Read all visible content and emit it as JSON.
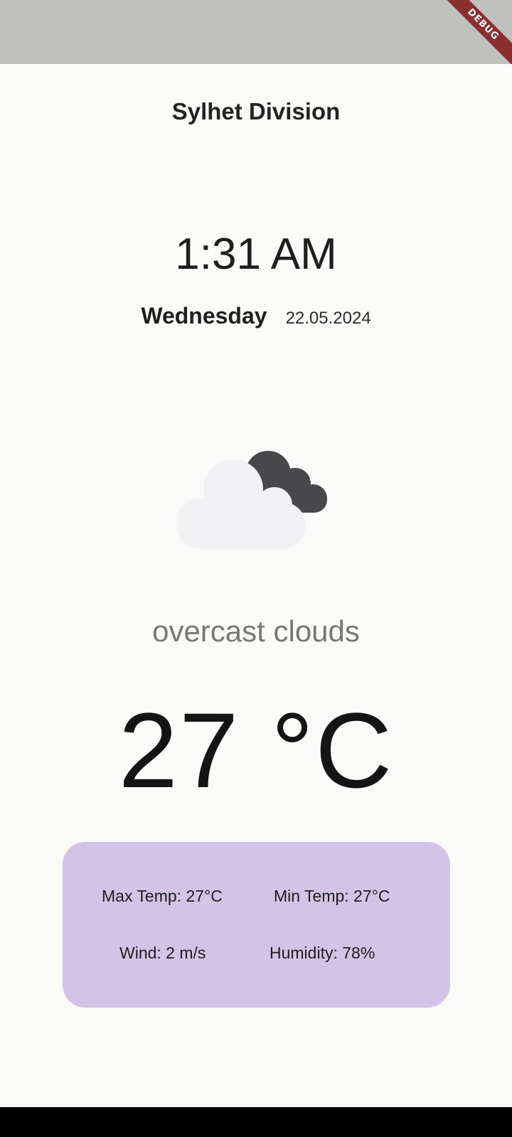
{
  "debug_banner": "DEBUG",
  "location": "Sylhet Division",
  "time": "1:31 AM",
  "day": "Wednesday",
  "date": "22.05.2024",
  "weather": {
    "icon": "overcast-clouds-icon",
    "description": "overcast clouds",
    "temperature": "27 °C"
  },
  "stats": {
    "max_temp": "Max Temp: 27°C",
    "min_temp": "Min Temp: 27°C",
    "wind": "Wind: 2 m/s",
    "humidity": "Humidity: 78%"
  },
  "colors": {
    "background": "#fafbf9",
    "status_bar": "#bfc0bd",
    "card": "#d2c3e7",
    "cloud_light": "#f2f2f4",
    "cloud_dark": "#48474a",
    "debug_ribbon": "#8b2e30"
  }
}
